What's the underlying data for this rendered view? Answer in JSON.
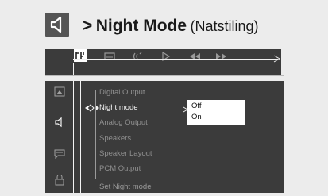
{
  "header": {
    "icon": "speaker-icon",
    "arrow": ">",
    "title": "Night Mode",
    "subtitle": "(Natstiling)"
  },
  "menu_bar": {
    "icons": [
      "settings-icon",
      "subtitle-icon",
      "audio-icon",
      "play-icon",
      "rewind-icon",
      "fast-forward-icon"
    ]
  },
  "sidebar": {
    "icons": [
      "picture-setup-icon",
      "speaker-icon",
      "subtitle-bubble-icon",
      "lock-icon"
    ]
  },
  "menu": {
    "items": [
      "Digital Output",
      "Night mode",
      "Analog Output",
      "Speakers",
      "Speaker Layout",
      "PCM Output"
    ],
    "active_index": 1
  },
  "options": {
    "items": [
      "Off",
      "On"
    ],
    "selected": "Off"
  },
  "status": "Set Night mode",
  "colors": {
    "background": "#ececec",
    "panel": "#3b3b3b",
    "text_active": "#f5f5f5",
    "text_inactive": "#8f8f8f"
  }
}
